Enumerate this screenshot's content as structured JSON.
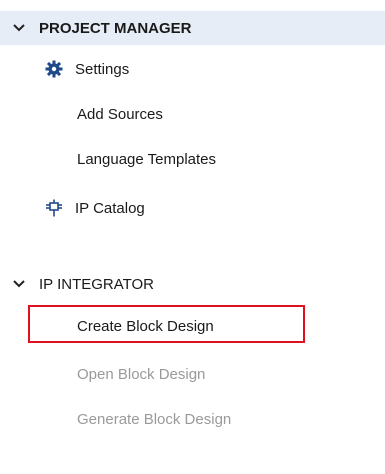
{
  "flow_navigator": {
    "sections": [
      {
        "label": "PROJECT MANAGER",
        "expanded": true,
        "items": [
          {
            "label": "Settings",
            "icon": "gear-icon",
            "enabled": true
          },
          {
            "label": "Add Sources",
            "enabled": true
          },
          {
            "label": "Language Templates",
            "enabled": true
          },
          {
            "label": "IP Catalog",
            "icon": "ip-core-icon",
            "enabled": true
          }
        ]
      },
      {
        "label": "IP INTEGRATOR",
        "expanded": true,
        "items": [
          {
            "label": "Create Block Design",
            "enabled": true,
            "highlighted": true
          },
          {
            "label": "Open Block Design",
            "enabled": false
          },
          {
            "label": "Generate Block Design",
            "enabled": false
          }
        ]
      }
    ]
  },
  "colors": {
    "header_band": "#e7edf6",
    "highlight_border": "#e0101e",
    "disabled_text": "#9a9a9a",
    "icon_blue": "#1f4a8a"
  }
}
